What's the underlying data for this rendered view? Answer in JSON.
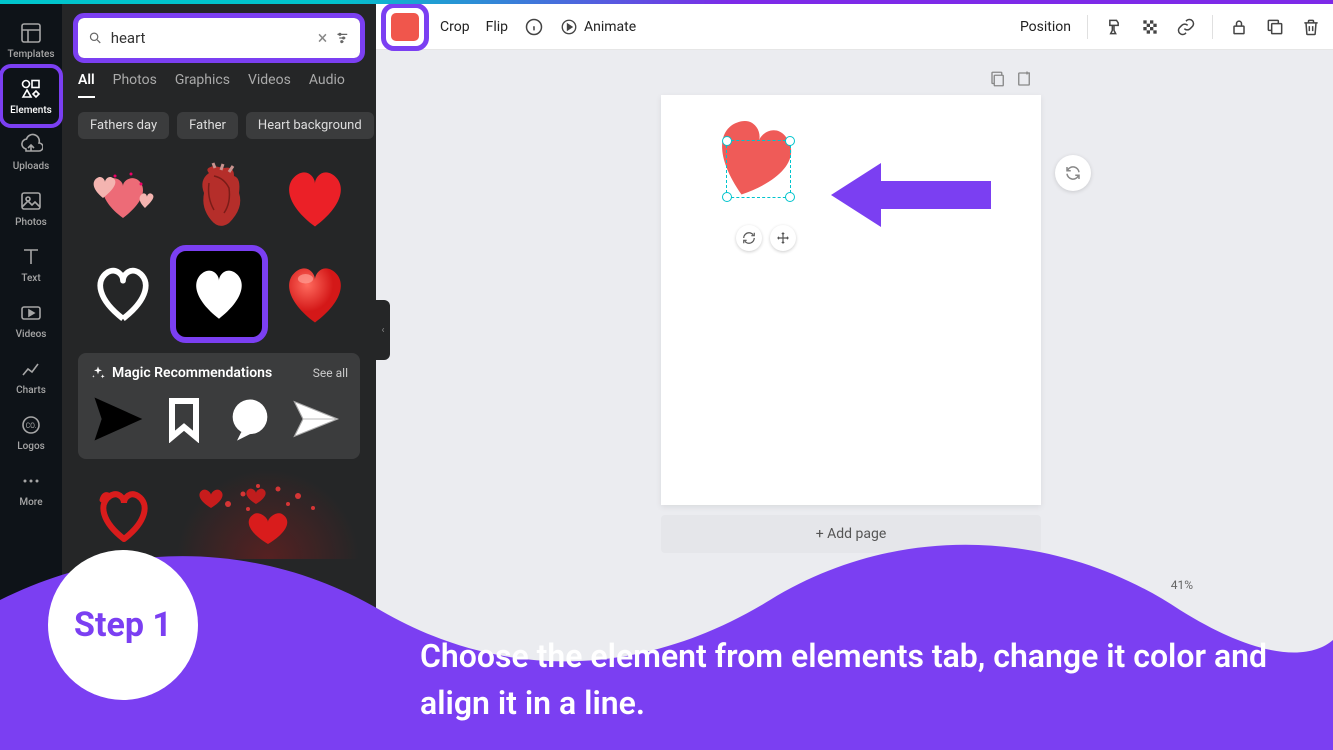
{
  "rail": {
    "items": [
      {
        "label": "Templates"
      },
      {
        "label": "Elements",
        "active": true
      },
      {
        "label": "Uploads"
      },
      {
        "label": "Photos"
      },
      {
        "label": "Text"
      },
      {
        "label": "Videos"
      },
      {
        "label": "Charts"
      },
      {
        "label": "Logos"
      },
      {
        "label": "More"
      }
    ]
  },
  "search": {
    "value": "heart"
  },
  "tabs": [
    "All",
    "Photos",
    "Graphics",
    "Videos",
    "Audio"
  ],
  "chips": [
    "Fathers day",
    "Father",
    "Heart background"
  ],
  "magic": {
    "title": "Magic Recommendations",
    "seeall": "See all"
  },
  "toolbar": {
    "color": "#f0564c",
    "crop": "Crop",
    "flip": "Flip",
    "animate": "Animate",
    "position": "Position"
  },
  "canvas": {
    "addpage": "+ Add page"
  },
  "zoom_value": "41%",
  "tutorial": {
    "step_label": "Step 1",
    "instruction": "Choose the element from elements tab, change it color and align it in a line."
  }
}
